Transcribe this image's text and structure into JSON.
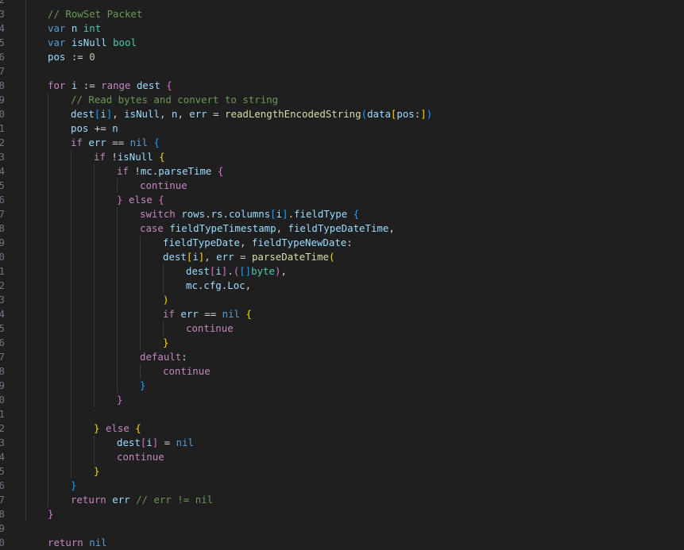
{
  "editor": {
    "theme": {
      "background": "#1f1f1f",
      "line_number": "#6e7681",
      "comment": "#6a9955",
      "keyword": "#569cd6",
      "control": "#c586c0",
      "type": "#4ec9b0",
      "variable": "#9cdcfe",
      "function": "#dcdcaa",
      "number": "#b5cea8",
      "bracket_gold": "#ffd700",
      "bracket_orchid": "#da70d6",
      "bracket_blue": "#179fff"
    },
    "lines": [
      {
        "n": "2",
        "indent": 0,
        "tokens": []
      },
      {
        "n": "3",
        "indent": 0,
        "tokens": [
          {
            "t": "// RowSet Packet",
            "c": "comment"
          }
        ]
      },
      {
        "n": "4",
        "indent": 0,
        "tokens": [
          {
            "t": "var",
            "c": "kw"
          },
          {
            "t": " ",
            "c": "plain"
          },
          {
            "t": "n",
            "c": "var"
          },
          {
            "t": " ",
            "c": "plain"
          },
          {
            "t": "int",
            "c": "type"
          }
        ]
      },
      {
        "n": "5",
        "indent": 0,
        "tokens": [
          {
            "t": "var",
            "c": "kw"
          },
          {
            "t": " ",
            "c": "plain"
          },
          {
            "t": "isNull",
            "c": "var"
          },
          {
            "t": " ",
            "c": "plain"
          },
          {
            "t": "bool",
            "c": "type"
          }
        ]
      },
      {
        "n": "6",
        "indent": 0,
        "tokens": [
          {
            "t": "pos",
            "c": "var"
          },
          {
            "t": " := ",
            "c": "plain"
          },
          {
            "t": "0",
            "c": "num"
          }
        ]
      },
      {
        "n": "7",
        "indent": 0,
        "tokens": []
      },
      {
        "n": "8",
        "indent": 0,
        "tokens": [
          {
            "t": "for",
            "c": "ctrl"
          },
          {
            "t": " ",
            "c": "plain"
          },
          {
            "t": "i",
            "c": "var"
          },
          {
            "t": " := ",
            "c": "plain"
          },
          {
            "t": "range",
            "c": "ctrl"
          },
          {
            "t": " ",
            "c": "plain"
          },
          {
            "t": "dest",
            "c": "var"
          },
          {
            "t": " ",
            "c": "plain"
          },
          {
            "t": "{",
            "c": "b2"
          }
        ]
      },
      {
        "n": "9",
        "indent": 1,
        "tokens": [
          {
            "t": "// Read bytes and convert to string",
            "c": "comment"
          }
        ]
      },
      {
        "n": "0",
        "indent": 1,
        "tokens": [
          {
            "t": "dest",
            "c": "var"
          },
          {
            "t": "[",
            "c": "b3"
          },
          {
            "t": "i",
            "c": "var"
          },
          {
            "t": "]",
            "c": "b3"
          },
          {
            "t": ", ",
            "c": "plain"
          },
          {
            "t": "isNull",
            "c": "var"
          },
          {
            "t": ", ",
            "c": "plain"
          },
          {
            "t": "n",
            "c": "var"
          },
          {
            "t": ", ",
            "c": "plain"
          },
          {
            "t": "err",
            "c": "var"
          },
          {
            "t": " = ",
            "c": "plain"
          },
          {
            "t": "readLengthEncodedString",
            "c": "fn"
          },
          {
            "t": "(",
            "c": "b3"
          },
          {
            "t": "data",
            "c": "var"
          },
          {
            "t": "[",
            "c": "b1"
          },
          {
            "t": "pos",
            "c": "var"
          },
          {
            "t": ":",
            "c": "plain"
          },
          {
            "t": "]",
            "c": "b1"
          },
          {
            "t": ")",
            "c": "b3"
          }
        ]
      },
      {
        "n": "1",
        "indent": 1,
        "tokens": [
          {
            "t": "pos",
            "c": "var"
          },
          {
            "t": " += ",
            "c": "plain"
          },
          {
            "t": "n",
            "c": "var"
          }
        ]
      },
      {
        "n": "2",
        "indent": 1,
        "tokens": [
          {
            "t": "if",
            "c": "ctrl"
          },
          {
            "t": " ",
            "c": "plain"
          },
          {
            "t": "err",
            "c": "var"
          },
          {
            "t": " == ",
            "c": "plain"
          },
          {
            "t": "nil",
            "c": "kw"
          },
          {
            "t": " ",
            "c": "plain"
          },
          {
            "t": "{",
            "c": "b3"
          }
        ]
      },
      {
        "n": "3",
        "indent": 2,
        "tokens": [
          {
            "t": "if",
            "c": "ctrl"
          },
          {
            "t": " !",
            "c": "plain"
          },
          {
            "t": "isNull",
            "c": "var"
          },
          {
            "t": " ",
            "c": "plain"
          },
          {
            "t": "{",
            "c": "b1"
          }
        ]
      },
      {
        "n": "4",
        "indent": 3,
        "tokens": [
          {
            "t": "if",
            "c": "ctrl"
          },
          {
            "t": " !",
            "c": "plain"
          },
          {
            "t": "mc",
            "c": "var"
          },
          {
            "t": ".",
            "c": "plain"
          },
          {
            "t": "parseTime",
            "c": "var"
          },
          {
            "t": " ",
            "c": "plain"
          },
          {
            "t": "{",
            "c": "b2"
          }
        ]
      },
      {
        "n": "5",
        "indent": 4,
        "tokens": [
          {
            "t": "continue",
            "c": "ctrl"
          }
        ]
      },
      {
        "n": "6",
        "indent": 3,
        "tokens": [
          {
            "t": "}",
            "c": "b2"
          },
          {
            "t": " ",
            "c": "plain"
          },
          {
            "t": "else",
            "c": "ctrl"
          },
          {
            "t": " ",
            "c": "plain"
          },
          {
            "t": "{",
            "c": "b2"
          }
        ]
      },
      {
        "n": "7",
        "indent": 4,
        "tokens": [
          {
            "t": "switch",
            "c": "ctrl"
          },
          {
            "t": " ",
            "c": "plain"
          },
          {
            "t": "rows",
            "c": "var"
          },
          {
            "t": ".",
            "c": "plain"
          },
          {
            "t": "rs",
            "c": "var"
          },
          {
            "t": ".",
            "c": "plain"
          },
          {
            "t": "columns",
            "c": "var"
          },
          {
            "t": "[",
            "c": "b3"
          },
          {
            "t": "i",
            "c": "var"
          },
          {
            "t": "]",
            "c": "b3"
          },
          {
            "t": ".",
            "c": "plain"
          },
          {
            "t": "fieldType",
            "c": "var"
          },
          {
            "t": " ",
            "c": "plain"
          },
          {
            "t": "{",
            "c": "b3"
          }
        ]
      },
      {
        "n": "8",
        "indent": 4,
        "tokens": [
          {
            "t": "case",
            "c": "ctrl"
          },
          {
            "t": " ",
            "c": "plain"
          },
          {
            "t": "fieldTypeTimestamp",
            "c": "var"
          },
          {
            "t": ", ",
            "c": "plain"
          },
          {
            "t": "fieldTypeDateTime",
            "c": "var"
          },
          {
            "t": ",",
            "c": "plain"
          }
        ]
      },
      {
        "n": "9",
        "indent": 5,
        "tokens": [
          {
            "t": "fieldTypeDate",
            "c": "var"
          },
          {
            "t": ", ",
            "c": "plain"
          },
          {
            "t": "fieldTypeNewDate",
            "c": "var"
          },
          {
            "t": ":",
            "c": "plain"
          }
        ]
      },
      {
        "n": "0",
        "indent": 5,
        "tokens": [
          {
            "t": "dest",
            "c": "var"
          },
          {
            "t": "[",
            "c": "b1"
          },
          {
            "t": "i",
            "c": "var"
          },
          {
            "t": "]",
            "c": "b1"
          },
          {
            "t": ", ",
            "c": "plain"
          },
          {
            "t": "err",
            "c": "var"
          },
          {
            "t": " = ",
            "c": "plain"
          },
          {
            "t": "parseDateTime",
            "c": "fn"
          },
          {
            "t": "(",
            "c": "b1"
          }
        ]
      },
      {
        "n": "1",
        "indent": 6,
        "tokens": [
          {
            "t": "dest",
            "c": "var"
          },
          {
            "t": "[",
            "c": "b2"
          },
          {
            "t": "i",
            "c": "var"
          },
          {
            "t": "]",
            "c": "b2"
          },
          {
            "t": ".",
            "c": "plain"
          },
          {
            "t": "(",
            "c": "b2"
          },
          {
            "t": "[",
            "c": "b3"
          },
          {
            "t": "]",
            "c": "b3"
          },
          {
            "t": "byte",
            "c": "type"
          },
          {
            "t": ")",
            "c": "b2"
          },
          {
            "t": ",",
            "c": "plain"
          }
        ]
      },
      {
        "n": "2",
        "indent": 6,
        "tokens": [
          {
            "t": "mc",
            "c": "var"
          },
          {
            "t": ".",
            "c": "plain"
          },
          {
            "t": "cfg",
            "c": "var"
          },
          {
            "t": ".",
            "c": "plain"
          },
          {
            "t": "Loc",
            "c": "var"
          },
          {
            "t": ",",
            "c": "plain"
          }
        ]
      },
      {
        "n": "3",
        "indent": 5,
        "tokens": [
          {
            "t": ")",
            "c": "b1"
          }
        ]
      },
      {
        "n": "4",
        "indent": 5,
        "tokens": [
          {
            "t": "if",
            "c": "ctrl"
          },
          {
            "t": " ",
            "c": "plain"
          },
          {
            "t": "err",
            "c": "var"
          },
          {
            "t": " == ",
            "c": "plain"
          },
          {
            "t": "nil",
            "c": "kw"
          },
          {
            "t": " ",
            "c": "plain"
          },
          {
            "t": "{",
            "c": "b1"
          }
        ]
      },
      {
        "n": "5",
        "indent": 6,
        "tokens": [
          {
            "t": "continue",
            "c": "ctrl"
          }
        ]
      },
      {
        "n": "6",
        "indent": 5,
        "tokens": [
          {
            "t": "}",
            "c": "b1"
          }
        ]
      },
      {
        "n": "7",
        "indent": 4,
        "tokens": [
          {
            "t": "default",
            "c": "ctrl"
          },
          {
            "t": ":",
            "c": "plain"
          }
        ]
      },
      {
        "n": "8",
        "indent": 5,
        "tokens": [
          {
            "t": "continue",
            "c": "ctrl"
          }
        ]
      },
      {
        "n": "9",
        "indent": 4,
        "tokens": [
          {
            "t": "}",
            "c": "b3"
          }
        ]
      },
      {
        "n": "0",
        "indent": 3,
        "tokens": [
          {
            "t": "}",
            "c": "b2"
          }
        ]
      },
      {
        "n": "1",
        "indent": 0,
        "tokens": []
      },
      {
        "n": "2",
        "indent": 2,
        "tokens": [
          {
            "t": "}",
            "c": "b1"
          },
          {
            "t": " ",
            "c": "plain"
          },
          {
            "t": "else",
            "c": "ctrl"
          },
          {
            "t": " ",
            "c": "plain"
          },
          {
            "t": "{",
            "c": "b1"
          }
        ]
      },
      {
        "n": "3",
        "indent": 3,
        "tokens": [
          {
            "t": "dest",
            "c": "var"
          },
          {
            "t": "[",
            "c": "b2"
          },
          {
            "t": "i",
            "c": "var"
          },
          {
            "t": "]",
            "c": "b2"
          },
          {
            "t": " = ",
            "c": "plain"
          },
          {
            "t": "nil",
            "c": "kw"
          }
        ]
      },
      {
        "n": "4",
        "indent": 3,
        "tokens": [
          {
            "t": "continue",
            "c": "ctrl"
          }
        ]
      },
      {
        "n": "5",
        "indent": 2,
        "tokens": [
          {
            "t": "}",
            "c": "b1"
          }
        ]
      },
      {
        "n": "6",
        "indent": 1,
        "tokens": [
          {
            "t": "}",
            "c": "b3"
          }
        ]
      },
      {
        "n": "7",
        "indent": 1,
        "tokens": [
          {
            "t": "return",
            "c": "ctrl"
          },
          {
            "t": " ",
            "c": "plain"
          },
          {
            "t": "err",
            "c": "var"
          },
          {
            "t": " ",
            "c": "plain"
          },
          {
            "t": "// err != nil",
            "c": "comment"
          }
        ]
      },
      {
        "n": "8",
        "indent": 0,
        "tokens": [
          {
            "t": "}",
            "c": "b2"
          }
        ]
      },
      {
        "n": "9",
        "indent": 0,
        "tokens": []
      },
      {
        "n": "0",
        "indent": 0,
        "tokens": [
          {
            "t": "return",
            "c": "ctrl"
          },
          {
            "t": " ",
            "c": "plain"
          },
          {
            "t": "nil",
            "c": "kw"
          }
        ]
      }
    ]
  }
}
